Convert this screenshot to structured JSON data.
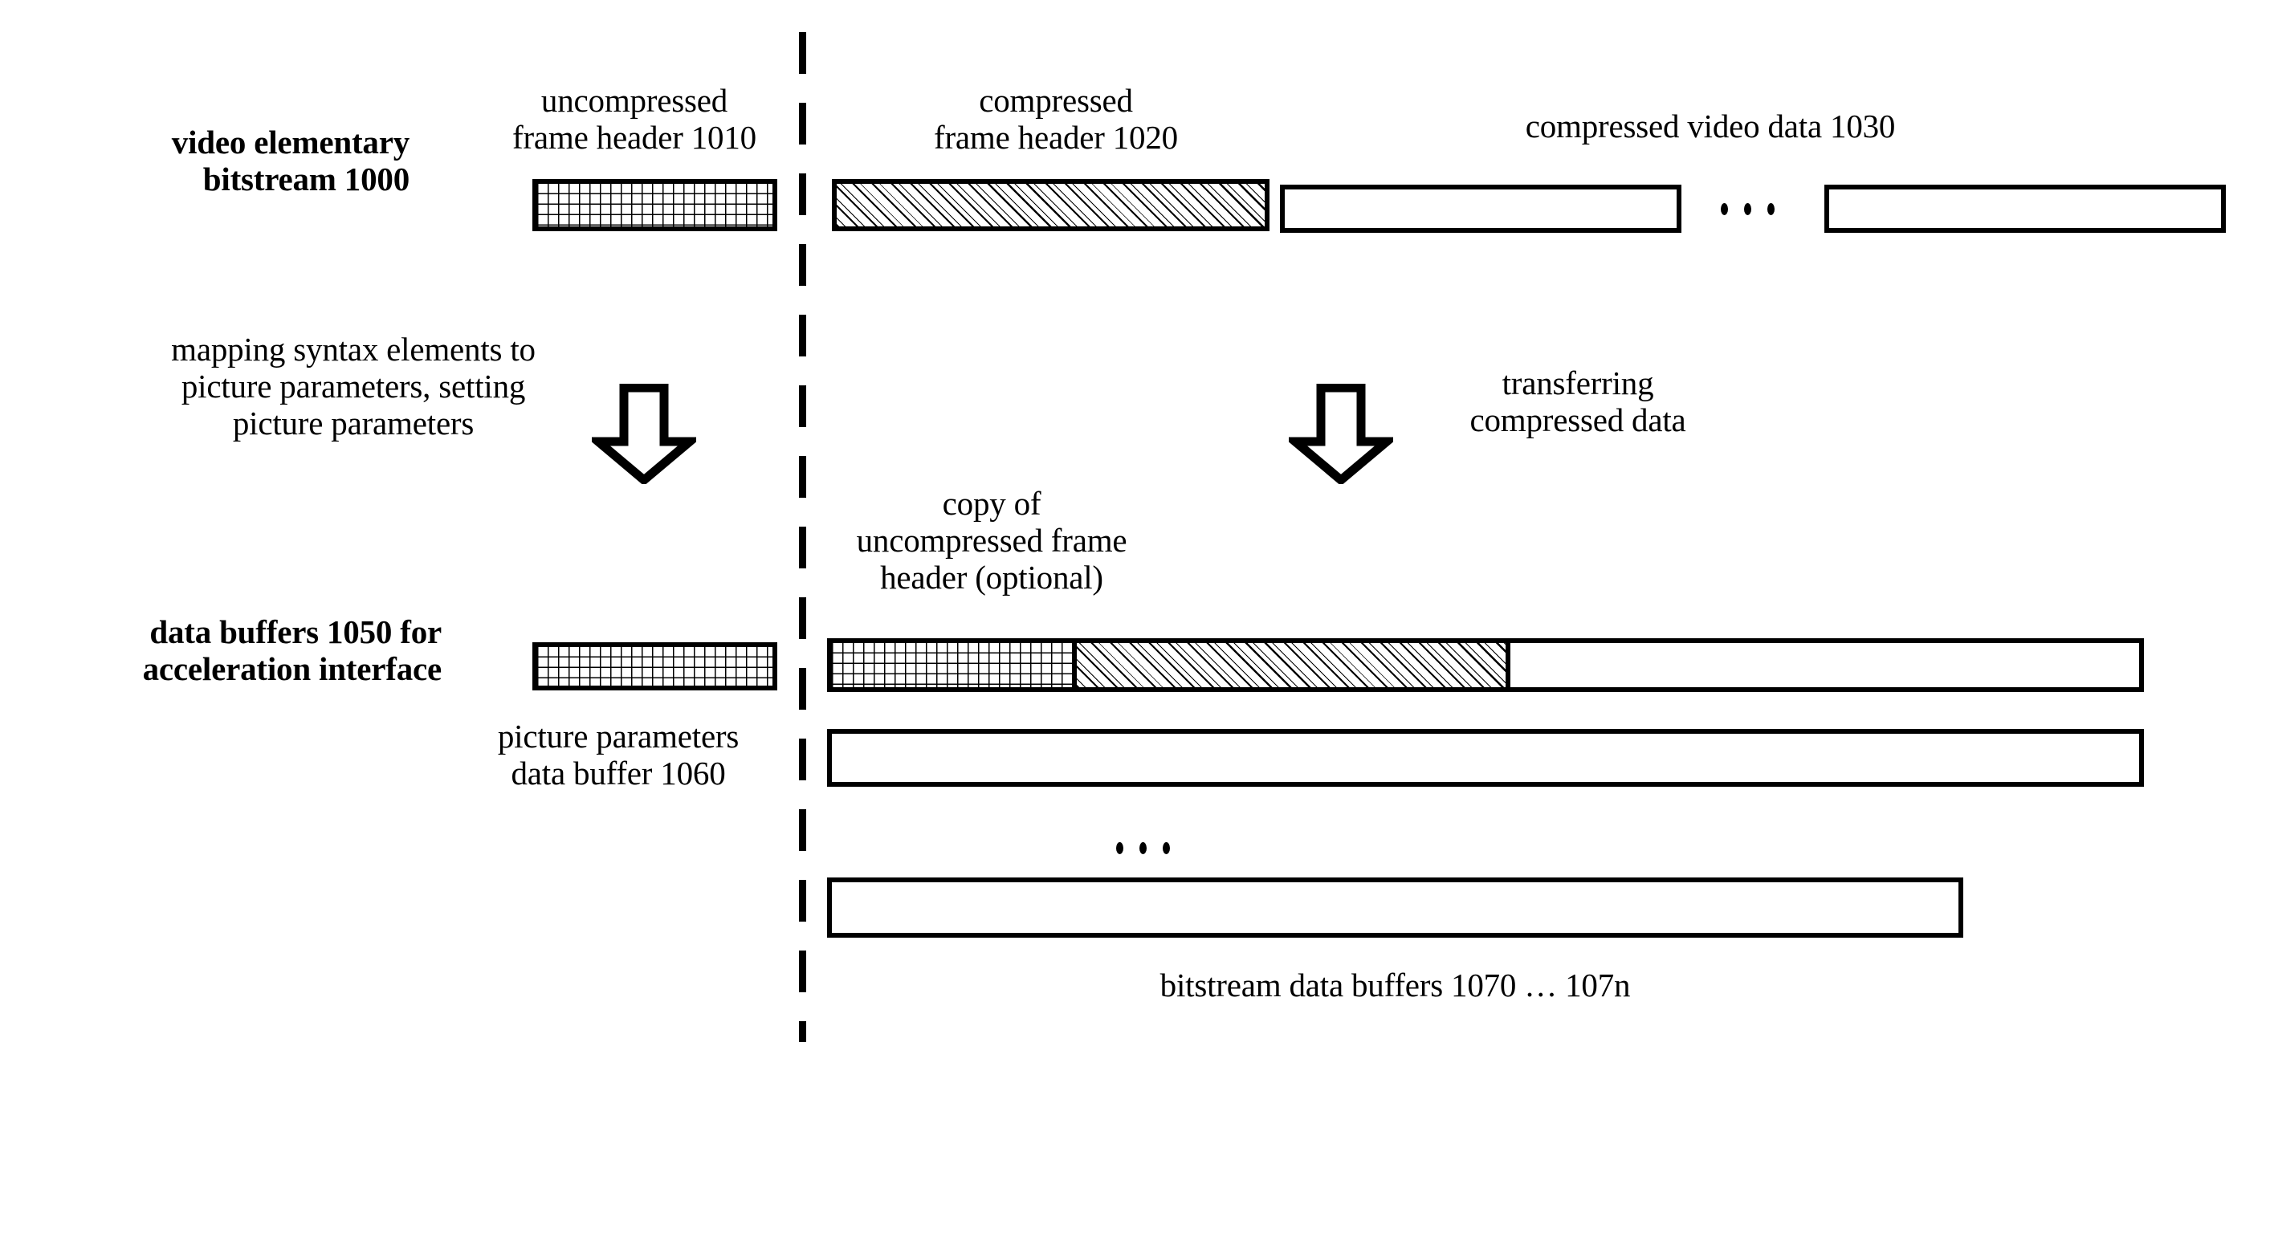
{
  "figure": {
    "title": "video elementary bitstream to acceleration interface data buffers",
    "stroke_color": "#000000",
    "background_color": "#ffffff"
  },
  "rows": {
    "bitstream": {
      "side_label": "video elementary\nbitstream 1000",
      "headers": {
        "uncompressed": "uncompressed\nframe header 1010",
        "compressed": "compressed\nframe header 1020",
        "video_data": "compressed video data 1030"
      },
      "ellipsis": "• • •"
    },
    "buffers": {
      "side_label": "data buffers 1050 for\nacceleration interface",
      "picture_params_label": "picture parameters\ndata buffer 1060",
      "copy_label": "copy of\nuncompressed frame\nheader (optional)",
      "bitstream_buffers_label": "bitstream data buffers 1070 … 107n",
      "ellipsis": "• • •"
    }
  },
  "arrows": {
    "left": {
      "caption": "mapping syntax elements to\npicture parameters, setting\npicture parameters",
      "direction": "down"
    },
    "right": {
      "caption": "transferring\ncompressed data",
      "direction": "down"
    }
  }
}
